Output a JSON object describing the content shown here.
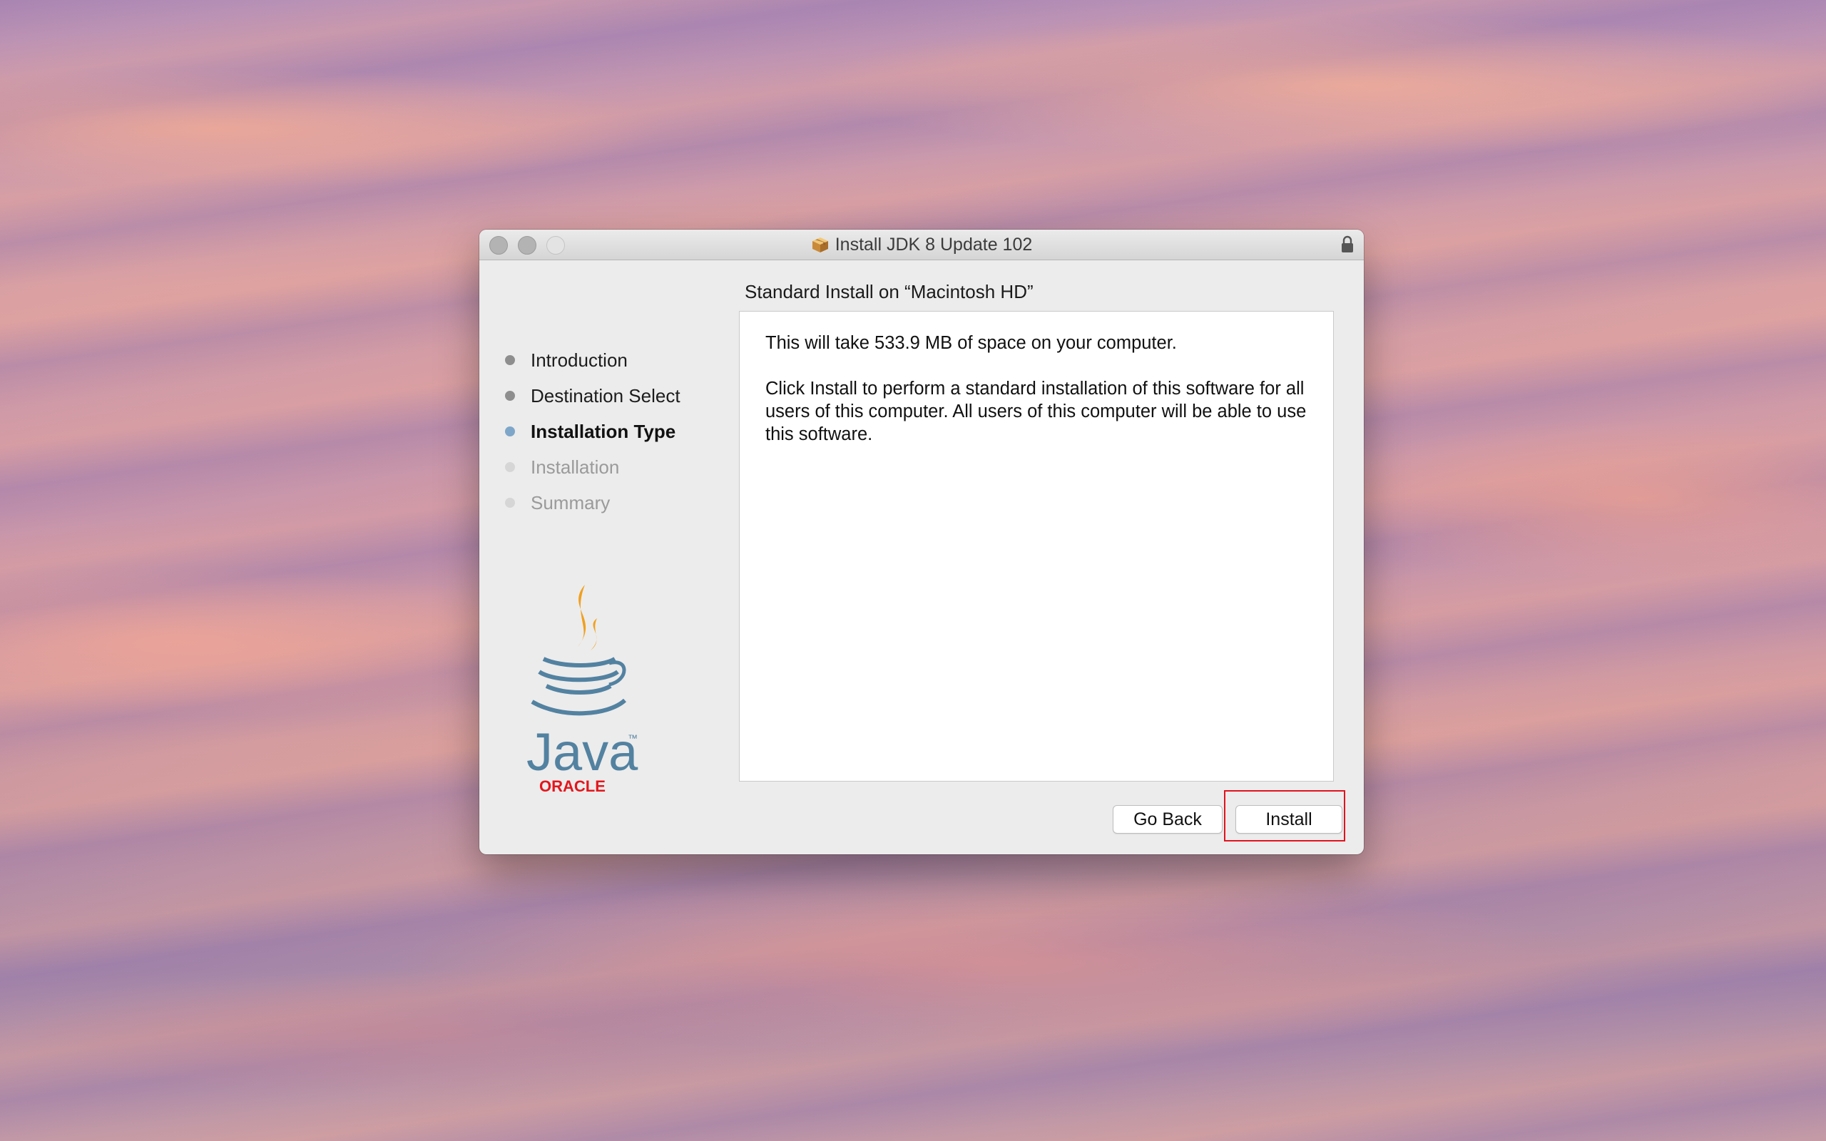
{
  "window": {
    "title": "Install JDK 8 Update 102"
  },
  "heading": "Standard Install on “Macintosh HD”",
  "content": {
    "paragraph1": "This will take 533.9 MB of space on your computer.",
    "paragraph2": "Click Install to perform a standard installation of this software for all users of this computer. All users of this computer will be able to use this software."
  },
  "steps": [
    {
      "label": "Introduction",
      "state": "done"
    },
    {
      "label": "Destination Select",
      "state": "done"
    },
    {
      "label": "Installation Type",
      "state": "current"
    },
    {
      "label": "Installation",
      "state": "todo"
    },
    {
      "label": "Summary",
      "state": "todo"
    }
  ],
  "logo": {
    "wordmark": "Java",
    "trademark": "™",
    "brand": "ORACLE",
    "colors": {
      "steam": "#f0a01e",
      "cup": "#5382a1",
      "oracle": "#e3161c"
    }
  },
  "buttons": {
    "back_label": "Go Back",
    "install_label": "Install"
  },
  "annotation": {
    "highlight_color": "#e0141e"
  }
}
